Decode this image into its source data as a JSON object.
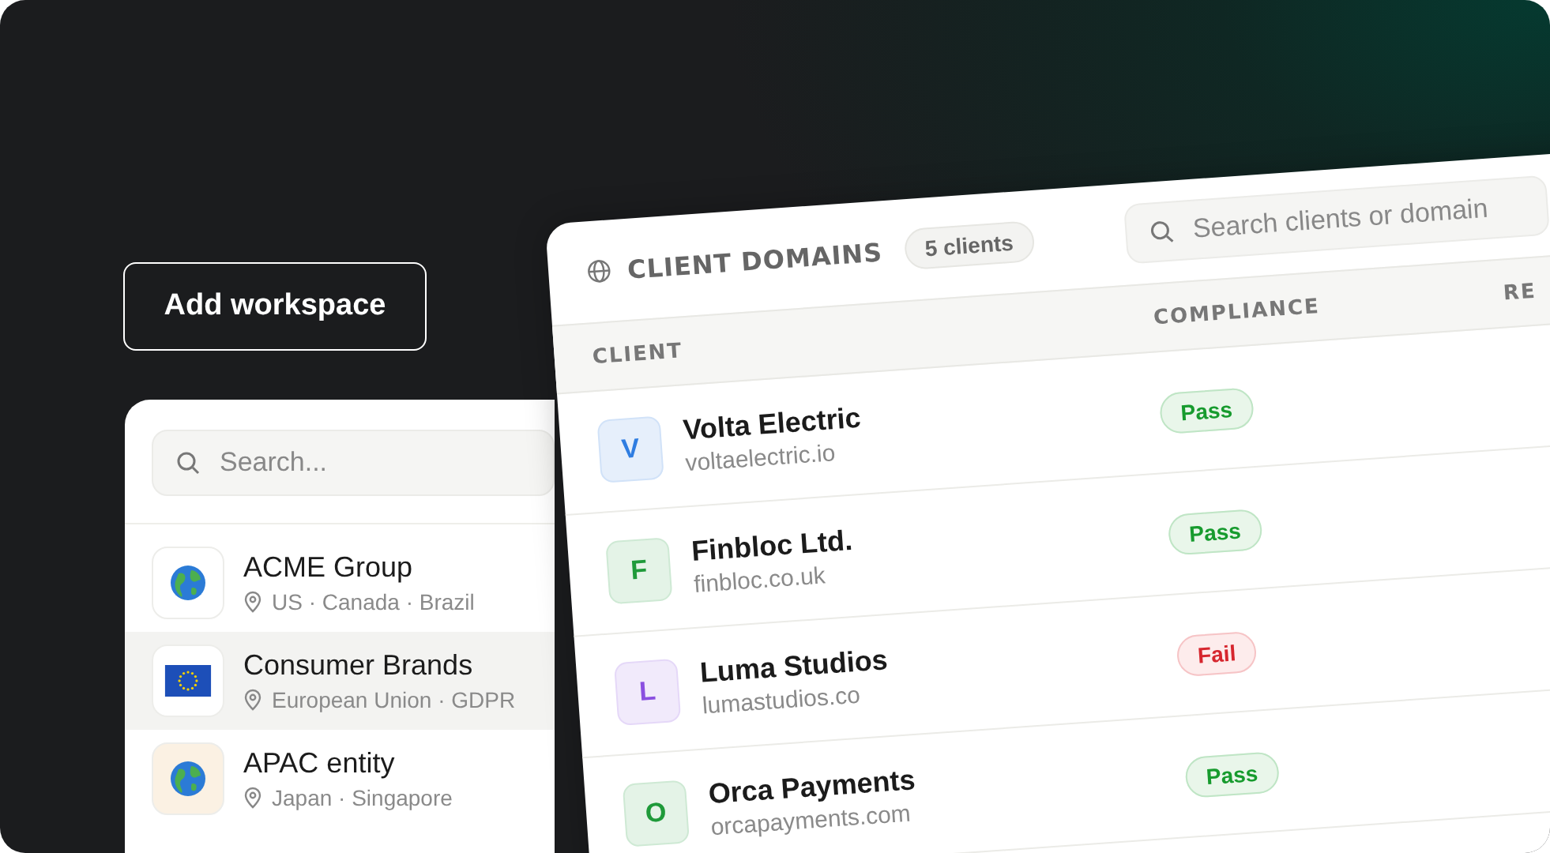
{
  "add_button": {
    "label": "Add workspace"
  },
  "workspaces": {
    "search": {
      "placeholder": "Search..."
    },
    "items": [
      {
        "name": "ACME Group",
        "location": "US · Canada · Brazil",
        "kind": "globe",
        "color": "#ffffff",
        "selected": false
      },
      {
        "name": "Consumer Brands",
        "location": "European Union · GDPR",
        "kind": "flag",
        "color": "#ffffff",
        "selected": true
      },
      {
        "name": "APAC entity",
        "location": "Japan · Singapore",
        "kind": "globe",
        "color": "#fbf1e3",
        "selected": false
      }
    ]
  },
  "clients": {
    "title": "CLIENT DOMAINS",
    "count": "5 clients",
    "search": {
      "placeholder": "Search clients or domain"
    },
    "columns": [
      "CLIENT",
      "COMPLIANCE",
      "RE"
    ],
    "rows": [
      {
        "initial": "V",
        "name": "Volta Electric",
        "domain": "voltaelectric.io",
        "color": "#2f7de1",
        "compliance": "Pass",
        "kind": "pass"
      },
      {
        "initial": "F",
        "name": "Finbloc Ltd.",
        "domain": "finbloc.co.uk",
        "color": "#1f9a3a",
        "compliance": "Pass",
        "kind": "pass"
      },
      {
        "initial": "L",
        "name": "Luma Studios",
        "domain": "lumastudios.co",
        "color": "#8a4fe0",
        "compliance": "Fail",
        "kind": "fail"
      },
      {
        "initial": "O",
        "name": "Orca Payments",
        "domain": "orcapayments.com",
        "color": "#1f9a3a",
        "compliance": "Pass",
        "kind": "pass"
      }
    ]
  }
}
